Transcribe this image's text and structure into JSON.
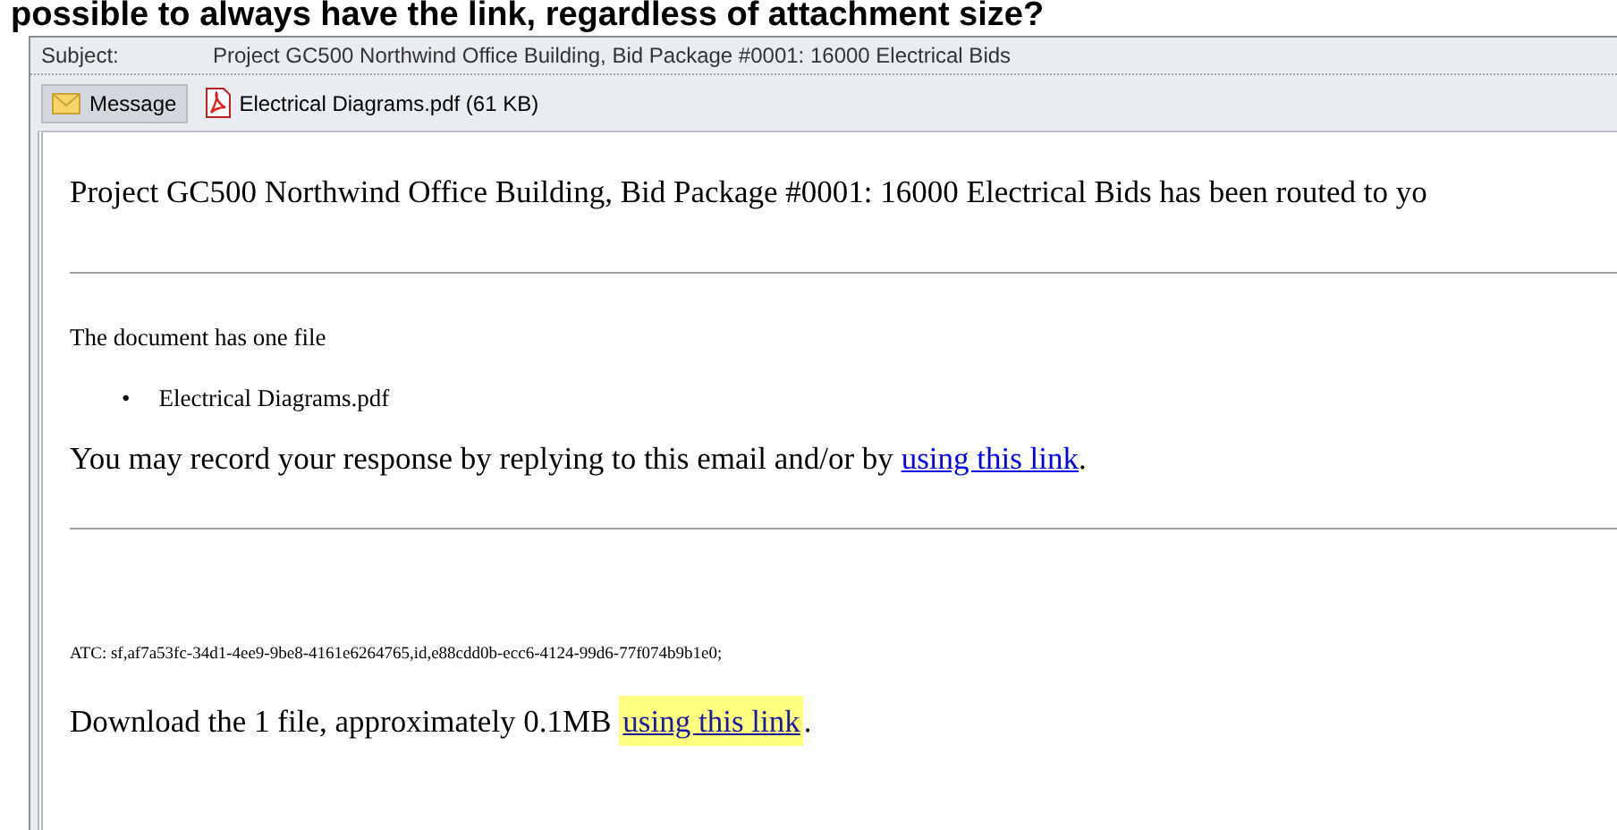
{
  "caption_above": "possible to always have the link, regardless of attachment size?",
  "header": {
    "subject_label": "Subject:",
    "subject": "Project GC500 Northwind Office Building, Bid Package #0001: 16000 Electrical Bids"
  },
  "tabs": [
    {
      "kind": "message",
      "label": "Message",
      "selected": true
    },
    {
      "kind": "pdf",
      "label": "Electrical Diagrams.pdf (61 KB)",
      "selected": false
    }
  ],
  "body": {
    "headline": "Project GC500 Northwind Office Building, Bid Package #0001: 16000 Electrical Bids has been routed to yo",
    "file_count": "The document has one file",
    "files": [
      {
        "bullet": "•",
        "name": "Electrical Diagrams.pdf"
      }
    ],
    "response_text": "You may record your response by replying to this email and/or by ",
    "response_link": "using this link",
    "response_end": ".",
    "atc": "ATC: sf,af7a53fc-34d1-4ee9-9be8-4161e6264765,id,e88cdd0b-ecc6-4124-99d6-77f074b9b1e0;",
    "download_text": "Download the 1 file, approximately 0.1MB ",
    "download_link": "using this link",
    "download_link_highlighted": true,
    "download_end": "."
  }
}
